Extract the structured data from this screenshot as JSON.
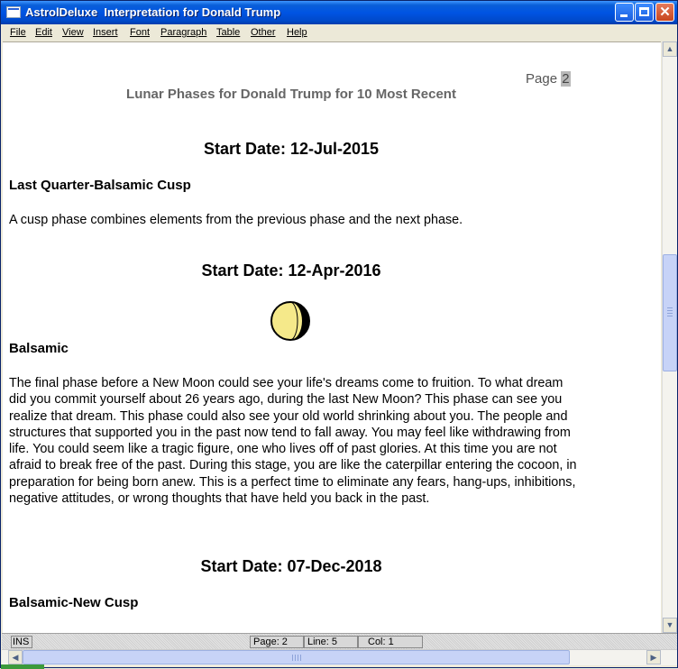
{
  "window": {
    "title": "AstrolDeluxe  Interpretation for Donald Trump"
  },
  "menu": [
    "File",
    "Edit",
    "View",
    "Insert",
    "Font",
    "Paragraph",
    "Table",
    "Other",
    "Help"
  ],
  "document": {
    "page_label": "Page",
    "page_number": "2",
    "report_title": "Lunar Phases for Donald Trump for 10 Most Recent",
    "entries": [
      {
        "start_date": "Start Date: 12-Jul-2015",
        "phase": "Last Quarter-Balsamic Cusp",
        "text": "A cusp phase combines elements from the previous phase and the next phase."
      },
      {
        "start_date": "Start Date: 12-Apr-2016",
        "phase": "Balsamic",
        "text": "The final phase before a New Moon could see your life's dreams come to fruition.  To what dream did you commit yourself about 26 years ago, during the last New Moon?  This phase can see you realize that dream.  This phase could also see your old world shrinking about you.  The people and structures that supported you in the past now tend to fall away.  You may feel like withdrawing from life.  You could seem like a tragic figure, one who lives off of past glories.  At this time you are not afraid to break free of the past.  During this stage, you are like the caterpillar entering the cocoon, in preparation for being born anew.  This is a perfect time to eliminate any fears, hang-ups, inhibitions, negative attitudes, or wrong thoughts that have held you back in the past."
      },
      {
        "start_date": "Start Date: 07-Dec-2018",
        "phase": "Balsamic-New Cusp"
      }
    ]
  },
  "status": {
    "mode": "INS",
    "page": "Page: 2",
    "line": "Line: 5",
    "col": "Col: 1"
  },
  "colors": {
    "titlebar": "#0054e3",
    "moon_light": "#f5e98a",
    "moon_dark": "#000000"
  }
}
